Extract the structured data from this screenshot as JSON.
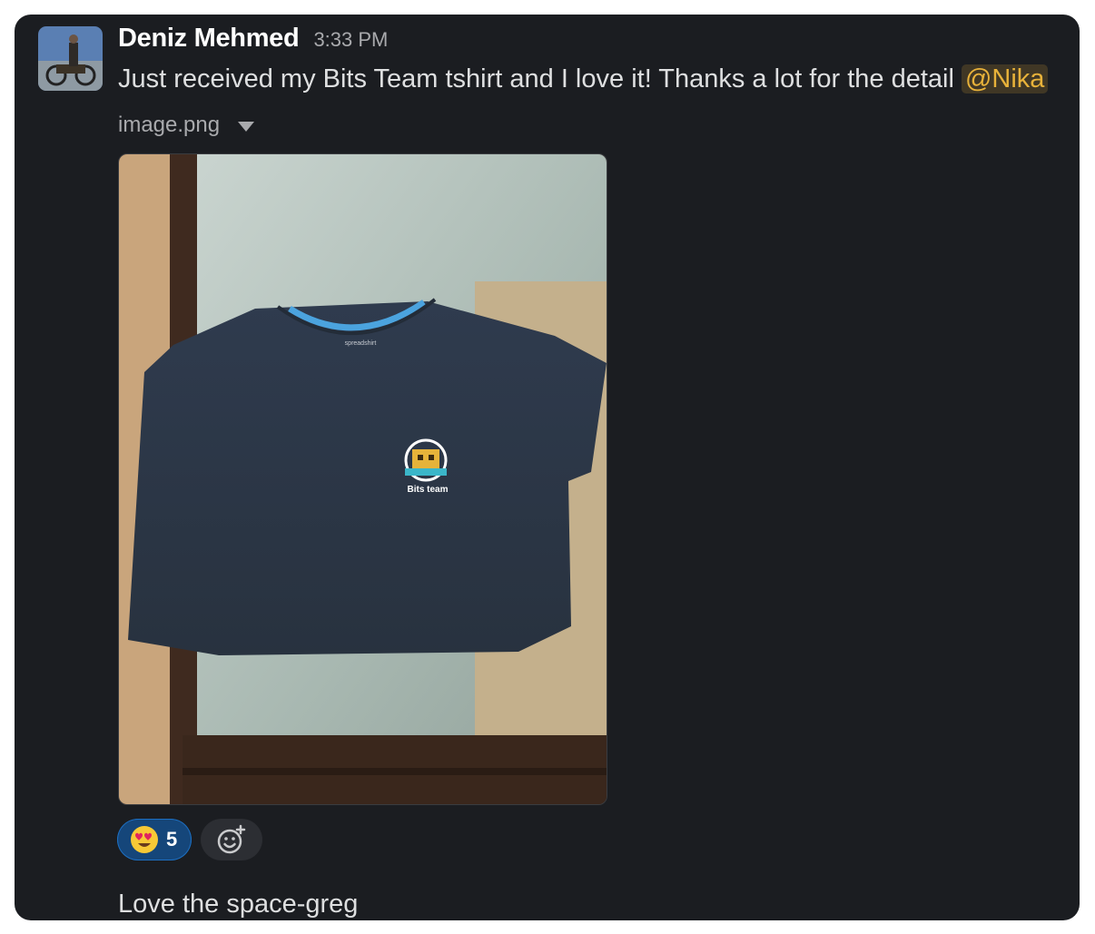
{
  "message": {
    "sender": "Deniz Mehmed",
    "timestamp": "3:33 PM",
    "text": "Just received my Bits Team tshirt and I love it! Thanks a lot for the detail",
    "mention": "@Nika"
  },
  "attachment": {
    "filename": "image.png",
    "shirt_brand": "spreadshirt",
    "shirt_print_label": "Bits team"
  },
  "reactions": [
    {
      "emoji": "heart-eyes-emoji",
      "count": "5"
    }
  ],
  "followup": {
    "text": "Love the space-greg"
  },
  "colors": {
    "card_bg": "#1b1d21",
    "mention": "#e8b23a",
    "reaction_bg": "#15467a"
  }
}
